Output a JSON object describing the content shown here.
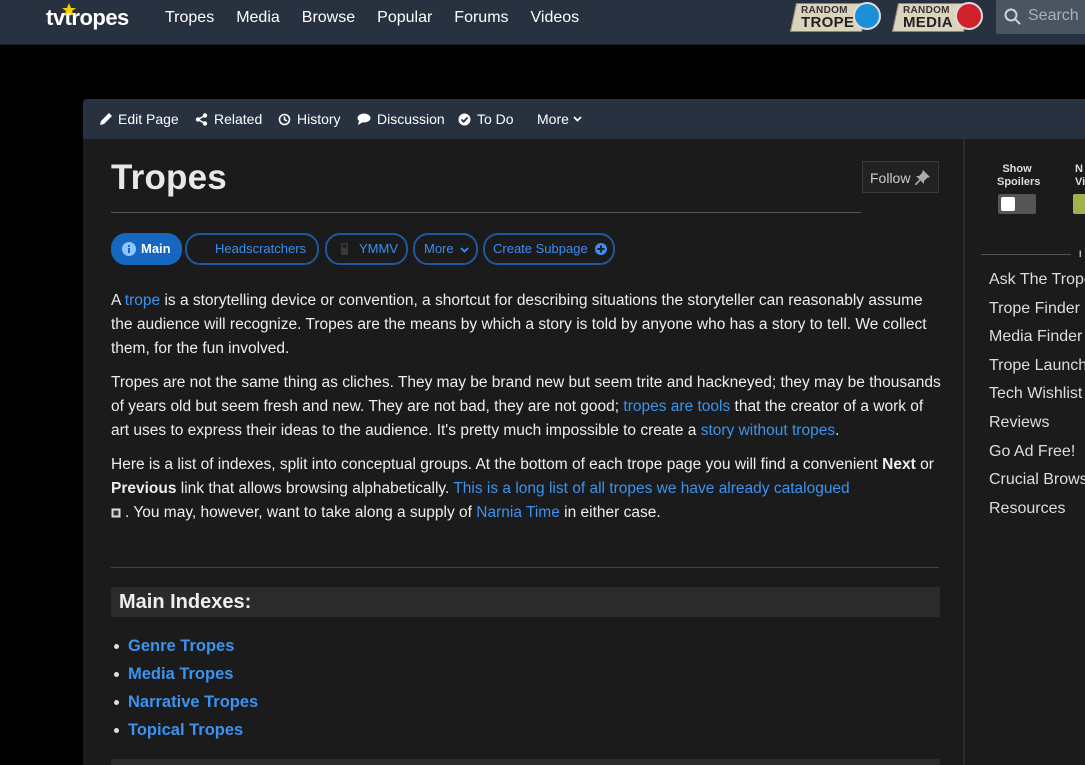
{
  "site": {
    "logo_text": "tvtropes",
    "nav": [
      "Tropes",
      "Media",
      "Browse",
      "Popular",
      "Forums",
      "Videos"
    ],
    "random_trope": {
      "top": "RANDOM",
      "bottom": "TROPE"
    },
    "random_media": {
      "top": "RANDOM",
      "bottom": "MEDIA"
    },
    "search_placeholder": "Search"
  },
  "actions": {
    "edit": "Edit Page",
    "related": "Related",
    "history": "History",
    "discussion": "Discussion",
    "todo": "To Do",
    "more": "More"
  },
  "page": {
    "title": "Tropes",
    "follow": "Follow",
    "tabs": {
      "main": "Main",
      "headscratchers": "Headscratchers",
      "ymmv": "YMMV",
      "more": "More",
      "create": "Create Subpage"
    },
    "p1": {
      "a": "A ",
      "link1": "trope",
      "b": " is a storytelling device or convention, a shortcut for describing situations the storyteller can reasonably assume the audience will recognize. Tropes are the means by which a story is told by anyone who has a story to tell. We collect them, for the fun involved."
    },
    "p2": {
      "a": "Tropes are not the same thing as cliches. They may be brand new but seem trite and hackneyed; they may be thousands of years old but seem fresh and new. They are not bad, they are not good; ",
      "link1": "tropes are tools",
      "b": " that the creator of a work of art uses to express their ideas to the audience. It's pretty much impossible to create a ",
      "link2": "story without tropes",
      "c": "."
    },
    "p3": {
      "a": "Here is a list of indexes, split into conceptual groups. At the bottom of each trope page you will find a convenient ",
      "bold1": "Next",
      "b": " or ",
      "bold2": "Previous",
      "c": " link that allows browsing alphabetically. ",
      "link1": "This is a long list of all tropes we have already catalogued",
      "d": ". You may, however, want to take along a supply of ",
      "link2": "Narnia Time",
      "e": " in either case."
    },
    "section_title": "Main Indexes:",
    "indexes": [
      "Genre Tropes",
      "Media Tropes",
      "Narrative Tropes",
      "Topical Tropes"
    ]
  },
  "sidebar": {
    "show_spoilers_1": "Show",
    "show_spoilers_2": "Spoilers",
    "night_1": "N",
    "night_2": "Vi",
    "section_label": "I",
    "links": [
      "Ask The Trope",
      "Trope Finder",
      "Media Finder",
      "Trope Launch",
      "Tech Wishlist",
      "Reviews",
      "Go Ad Free!",
      "Crucial Brows",
      "Resources"
    ]
  },
  "colors": {
    "link": "#3b93f0",
    "topbar": "#27313f",
    "accent": "#1567c0"
  }
}
